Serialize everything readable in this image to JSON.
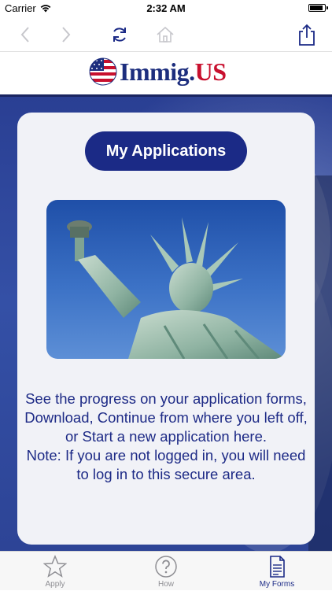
{
  "status_bar": {
    "carrier": "Carrier",
    "time": "2:32 AM"
  },
  "toolbar": {
    "back_icon": "chevron-left-icon",
    "forward_icon": "chevron-right-icon",
    "refresh_icon": "refresh-icon",
    "home_icon": "home-icon",
    "share_icon": "share-icon"
  },
  "logo": {
    "text_main": "Immig.",
    "text_accent": "US",
    "accent_color": "#c8102e",
    "main_color": "#1d2e7e"
  },
  "card": {
    "button_label": "My Applications",
    "description": "See the progress on your application forms, Download, Continue from where you left off, or Start a new application here.",
    "note": "Note: If you are not logged in, you will need to log in to this secure area."
  },
  "tab_bar": {
    "tabs": [
      {
        "label": "Apply",
        "icon": "star-icon",
        "active": false
      },
      {
        "label": "How",
        "icon": "question-icon",
        "active": false
      },
      {
        "label": "My Forms",
        "icon": "document-list-icon",
        "active": true
      }
    ],
    "active_color": "#1b2a86"
  }
}
